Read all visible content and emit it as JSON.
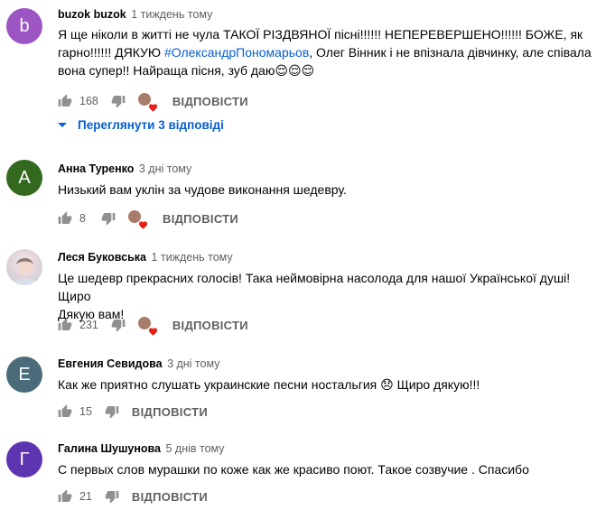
{
  "comments": [
    {
      "avatar_letter": "b",
      "avatar_color": "#9c55c2",
      "author": "buzok buzok",
      "time": "1 тиждень тому",
      "text_parts": [
        "Я ще ніколи в житті не чула ТАКОЇ РІЗДВЯНОЇ  пісні!!!!!! НЕПЕРЕВЕРШЕНО!!!!!! БОЖЕ, як гарно!!!!!! ДЯКУЮ ",
        "#ОлександрПономарьов",
        ",  Олег Вінник і не впізнала дівчинку, але співала вона супер!! Найраща пісня, зуб даю😌😌😌"
      ],
      "likes": "168",
      "reply_label": "ВІДПОВІСТИ",
      "has_heart": true,
      "view_replies_label": "Переглянути 3 відповіді"
    },
    {
      "avatar_letter": "A",
      "avatar_color": "#33691e",
      "author": "Анна Туренко",
      "time": "3 дні тому",
      "text": "Низький вам уклін за чудове виконання шедевру.",
      "likes": "8",
      "reply_label": "ВІДПОВІСТИ",
      "has_heart": true
    },
    {
      "avatar_letter": "",
      "avatar_color": "#e6dde2",
      "author": "Леся Буковська",
      "time": "1 тиждень тому",
      "text": "Це шедевр прекрасних голосів! Така неймовірна насолода для нашої Української душі!Щиро\nДякую вам!",
      "likes": "231",
      "reply_label": "ВІДПОВІСТИ",
      "has_heart": true
    },
    {
      "avatar_letter": "Е",
      "avatar_color": "#4c6b7a",
      "author": "Евгения Севидова",
      "time": "3 дні тому",
      "text": "Как же приятно слушать украинские песни ностальгия 😞  Щиро дякую!!!",
      "likes": "15",
      "reply_label": "ВІДПОВІСТИ",
      "has_heart": false
    },
    {
      "avatar_letter": "Г",
      "avatar_color": "#5e35b1",
      "author": "Галина Шушунова",
      "time": "5 днів тому",
      "text": "С первых слов мурашки по коже как же красиво поют. Такое созвучие . Спасибо",
      "likes": "21",
      "reply_label": "ВІДПОВІСТИ",
      "has_heart": false
    }
  ]
}
